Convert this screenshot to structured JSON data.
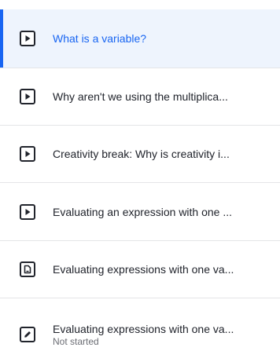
{
  "items": [
    {
      "title": "What is a variable?",
      "icon": "video-play-icon",
      "active": true
    },
    {
      "title": "Why aren't we using the multiplica...",
      "icon": "video-play-icon"
    },
    {
      "title": "Creativity break: Why is creativity i...",
      "icon": "video-play-icon"
    },
    {
      "title": "Evaluating an expression with one ...",
      "icon": "video-play-icon"
    },
    {
      "title": "Evaluating expressions with one va...",
      "icon": "article-icon"
    },
    {
      "title": "Evaluating expressions with one va...",
      "icon": "exercise-pencil-icon",
      "subtitle": "Not started"
    }
  ],
  "colors": {
    "accent": "#1865f2",
    "active_background": "#eef4fd",
    "text": "#21242c",
    "muted_text": "#6b6d74",
    "divider": "#e4e5e7"
  }
}
